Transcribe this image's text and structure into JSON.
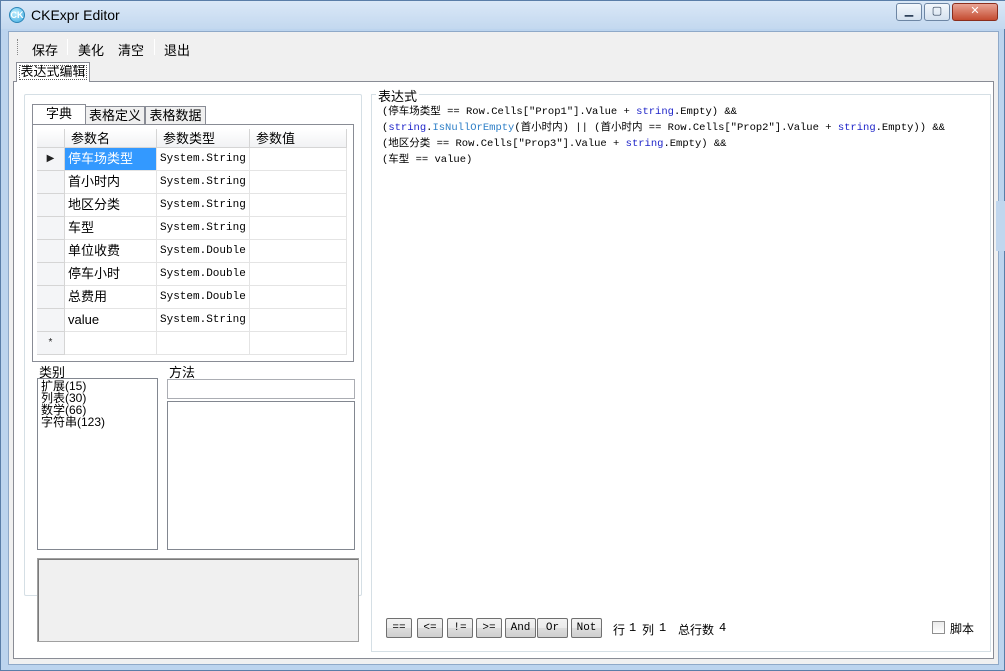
{
  "window": {
    "title": "CKExpr Editor",
    "icon_text": "CK"
  },
  "menu": {
    "save": "保存",
    "beautify": "美化",
    "clear": "清空",
    "exit": "退出"
  },
  "outer_tab": {
    "label": "表达式编辑"
  },
  "sub_tabs": [
    {
      "label": "字典",
      "active": true
    },
    {
      "label": "表格定义",
      "active": false
    },
    {
      "label": "表格数据",
      "active": false
    }
  ],
  "grid": {
    "headers": {
      "name": "参数名",
      "type": "参数类型",
      "value": "参数值"
    },
    "current_row_marker": "▶",
    "new_row_marker": "*",
    "rows": [
      {
        "name": "停车场类型",
        "type": "System.String",
        "value": ""
      },
      {
        "name": "首小时内",
        "type": "System.String",
        "value": ""
      },
      {
        "name": "地区分类",
        "type": "System.String",
        "value": ""
      },
      {
        "name": "车型",
        "type": "System.String",
        "value": ""
      },
      {
        "name": "单位收费",
        "type": "System.Double",
        "value": ""
      },
      {
        "name": "停车小时",
        "type": "System.Double",
        "value": ""
      },
      {
        "name": "总费用",
        "type": "System.Double",
        "value": ""
      },
      {
        "name": "value",
        "type": "System.String",
        "value": ""
      }
    ]
  },
  "category": {
    "label": "类别",
    "items": [
      "扩展(15)",
      "列表(30)",
      "数学(66)",
      "字符串(123)"
    ]
  },
  "method": {
    "label": "方法",
    "input_value": ""
  },
  "expression": {
    "label": "表达式",
    "lines": [
      "(停车场类型 == Row.Cells[\"Prop1\"].Value + string.Empty) &&",
      "(string.IsNullOrEmpty(首小时内) || (首小时内 == Row.Cells[\"Prop2\"].Value + string.Empty)) &&",
      "(地区分类 == Row.Cells[\"Prop3\"].Value + string.Empty) &&",
      "(车型 == value)"
    ]
  },
  "operators": [
    "==",
    "<=",
    "!=",
    ">=",
    "And",
    "Or",
    "Not"
  ],
  "status": {
    "row_label": "行",
    "row_value": "1",
    "col_label": "列",
    "col_value": "1",
    "total_label": "总行数",
    "total_value": "4"
  },
  "script_checkbox": {
    "label": "脚本",
    "checked": false
  }
}
